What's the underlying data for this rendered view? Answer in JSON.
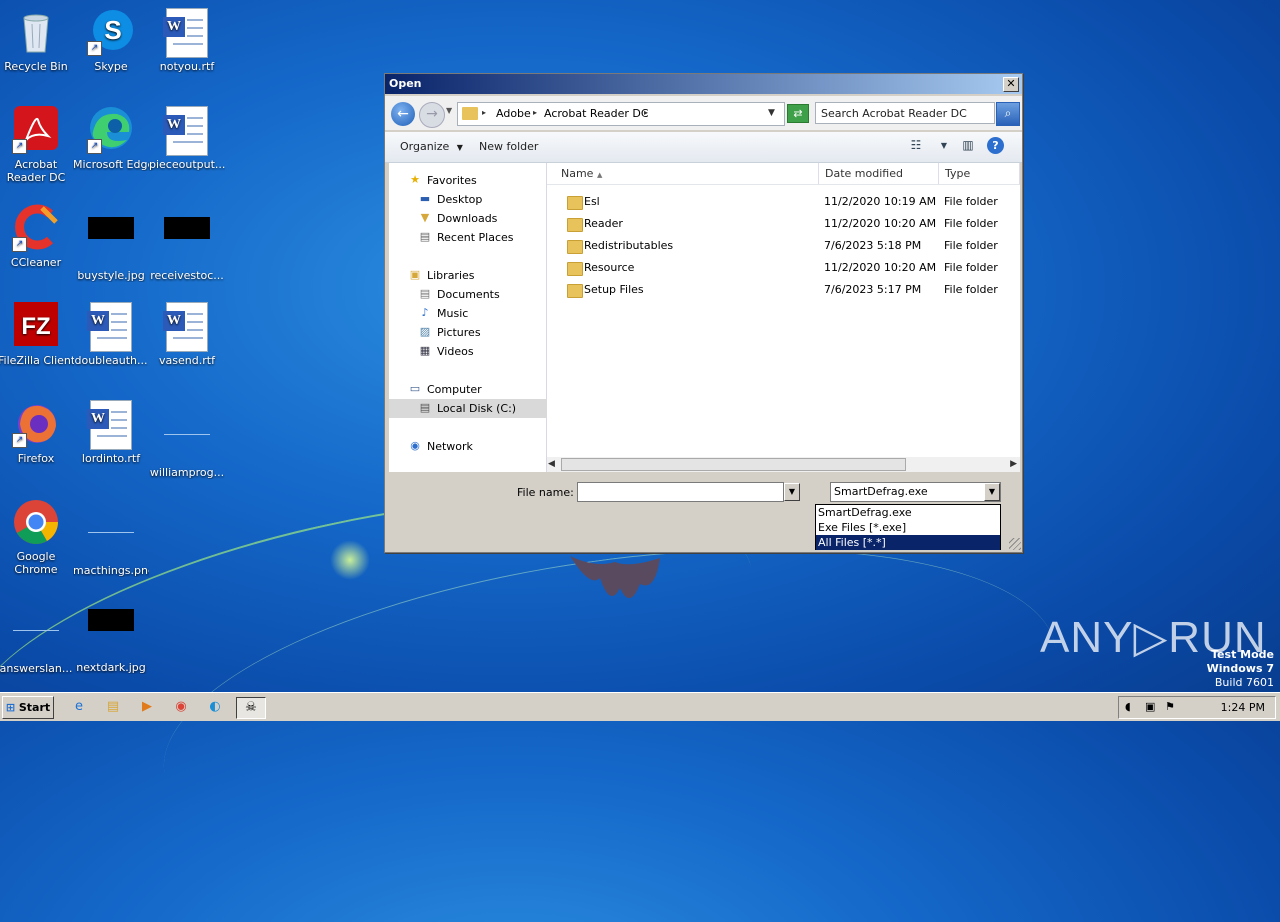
{
  "desktop": {
    "icons": [
      {
        "label": "Recycle Bin"
      },
      {
        "label": "Skype"
      },
      {
        "label": "notyou.rtf"
      },
      {
        "label": "Acrobat Reader DC"
      },
      {
        "label": "Microsoft Edge"
      },
      {
        "label": "pieceoutput..."
      },
      {
        "label": "CCleaner"
      },
      {
        "label": "buystyle.jpg"
      },
      {
        "label": "receivestoc..."
      },
      {
        "label": "FileZilla Client"
      },
      {
        "label": "doubleauth..."
      },
      {
        "label": "vasend.rtf"
      },
      {
        "label": "Firefox"
      },
      {
        "label": "lordinto.rtf"
      },
      {
        "label": "williamprog..."
      },
      {
        "label": "Google Chrome"
      },
      {
        "label": "macthings.png"
      },
      {
        "label": "answerslan..."
      },
      {
        "label": "nextdark.jpg"
      }
    ]
  },
  "dialog": {
    "title": "Open",
    "close": "✕",
    "address": {
      "crumbs": [
        "Adobe",
        "Acrobat Reader DC"
      ]
    },
    "search_placeholder": "Search Acrobat Reader DC",
    "toolbar": {
      "organize": "Organize",
      "new_folder": "New folder",
      "help": "?"
    },
    "nav": {
      "favorites": "Favorites",
      "desktop": "Desktop",
      "downloads": "Downloads",
      "recent": "Recent Places",
      "libraries": "Libraries",
      "documents": "Documents",
      "music": "Music",
      "pictures": "Pictures",
      "videos": "Videos",
      "computer": "Computer",
      "localdisk": "Local Disk (C:)",
      "network": "Network"
    },
    "columns": {
      "name": "Name",
      "date": "Date modified",
      "type": "Type"
    },
    "rows": [
      {
        "name": "Esl",
        "date": "11/2/2020 10:19 AM",
        "type": "File folder"
      },
      {
        "name": "Reader",
        "date": "11/2/2020 10:20 AM",
        "type": "File folder"
      },
      {
        "name": "Redistributables",
        "date": "7/6/2023 5:18 PM",
        "type": "File folder"
      },
      {
        "name": "Resource",
        "date": "11/2/2020 10:20 AM",
        "type": "File folder"
      },
      {
        "name": "Setup Files",
        "date": "7/6/2023 5:17 PM",
        "type": "File folder"
      }
    ],
    "file_name_label": "File name:",
    "file_name_value": "",
    "file_type_selected": "SmartDefrag.exe",
    "file_type_options": [
      "SmartDefrag.exe",
      "Exe Files [*.exe]",
      "All Files [*.*]"
    ]
  },
  "taskbar": {
    "start": "Start",
    "time": "1:24 PM"
  },
  "watermark": {
    "brand": "ANY▷RUN",
    "line1": "Test Mode",
    "line2": "Windows 7",
    "line3": "Build 7601"
  }
}
